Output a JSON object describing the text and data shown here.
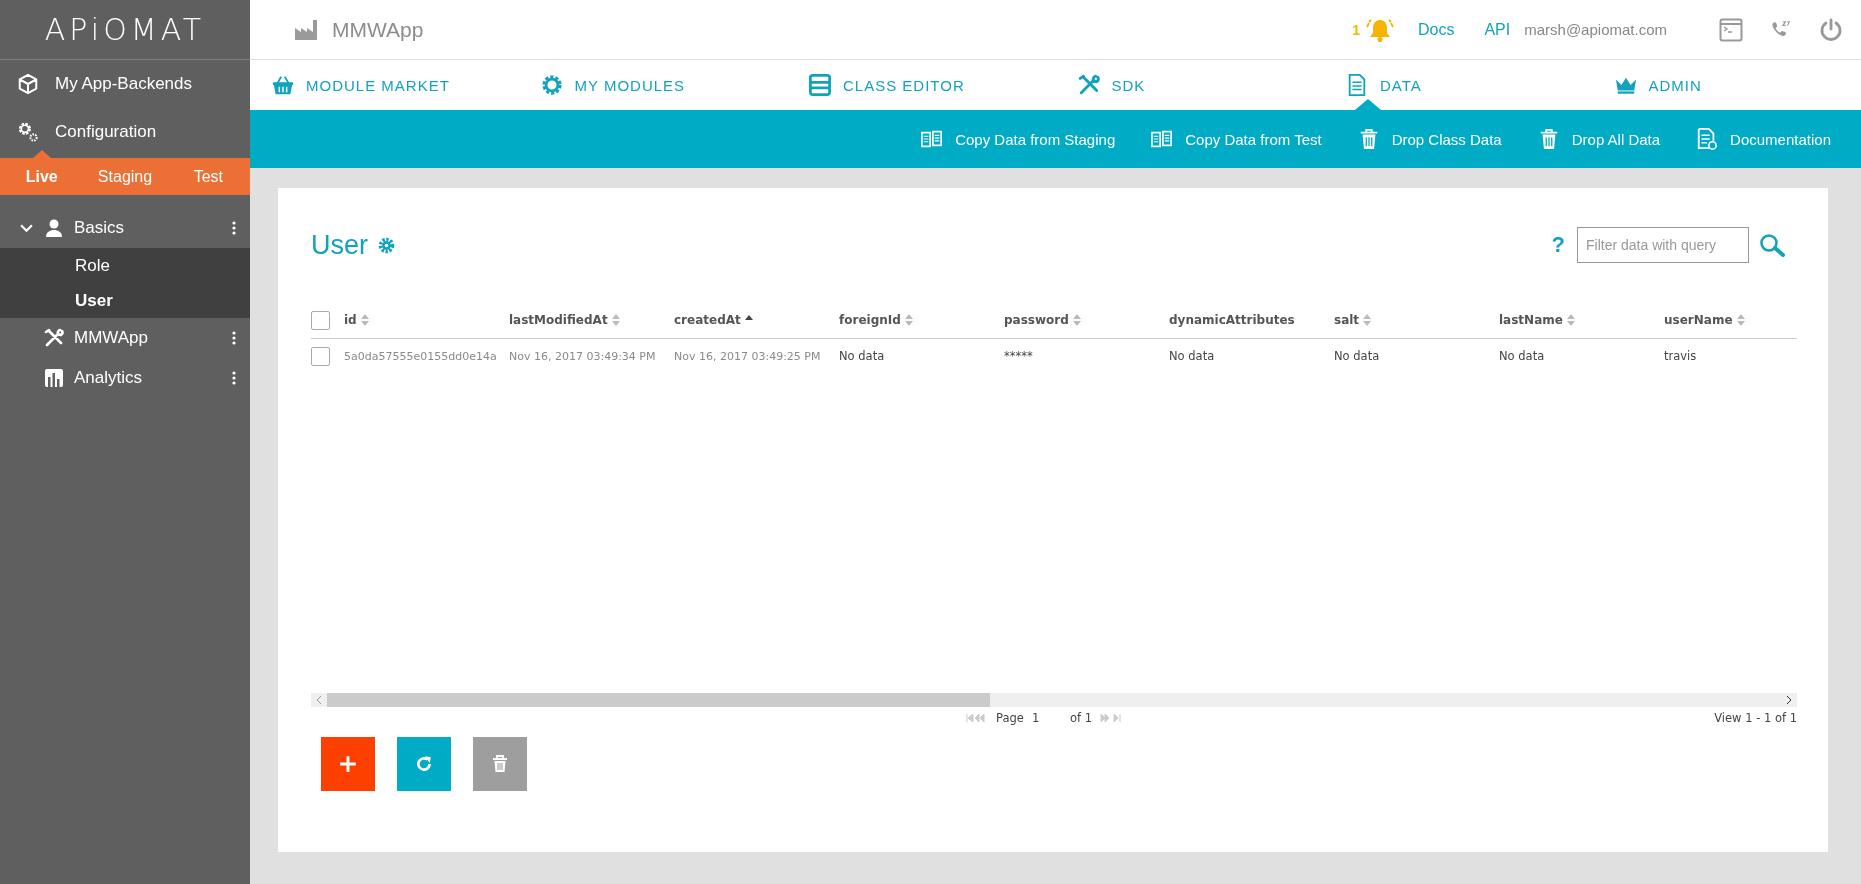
{
  "logo": "APiOMAT",
  "app_title": "MMWApp",
  "header": {
    "notification_count": "1",
    "links": [
      "Docs",
      "API"
    ],
    "user_email": "marsh@apiomat.com"
  },
  "sidebar": {
    "items": [
      {
        "label": "My App-Backends",
        "kind": "backends"
      },
      {
        "label": "Configuration",
        "kind": "configuration"
      }
    ],
    "environments": [
      {
        "label": "Live",
        "selected": true
      },
      {
        "label": "Staging",
        "selected": false
      },
      {
        "label": "Test",
        "selected": false
      }
    ],
    "tree": [
      {
        "label": "Basics",
        "kind": "user",
        "expanded": true,
        "children": [
          {
            "label": "Role",
            "selected": false
          },
          {
            "label": "User",
            "selected": true
          }
        ]
      },
      {
        "label": "MMWApp",
        "kind": "tools"
      },
      {
        "label": "Analytics",
        "kind": "chart"
      }
    ]
  },
  "nav_tabs": [
    {
      "label": "MODULE MARKET",
      "kind": "basket",
      "selected": false
    },
    {
      "label": "MY MODULES",
      "kind": "gear",
      "selected": false
    },
    {
      "label": "CLASS EDITOR",
      "kind": "editor",
      "selected": false
    },
    {
      "label": "SDK",
      "kind": "tools",
      "selected": false
    },
    {
      "label": "DATA",
      "kind": "document",
      "selected": true
    },
    {
      "label": "ADMIN",
      "kind": "crown",
      "selected": false
    }
  ],
  "actions": [
    {
      "label": "Copy Data from Staging",
      "kind": "copy"
    },
    {
      "label": "Copy Data from Test",
      "kind": "copy"
    },
    {
      "label": "Drop Class Data",
      "kind": "trash"
    },
    {
      "label": "Drop All Data",
      "kind": "trash"
    },
    {
      "label": "Documentation",
      "kind": "document"
    }
  ],
  "class_title": "User",
  "filter": {
    "help": "?",
    "placeholder": "Filter data with query"
  },
  "table": {
    "all_checked": false,
    "columns": [
      {
        "label": "id",
        "sortable": true,
        "sorted": false
      },
      {
        "label": "lastModifiedAt",
        "sortable": true,
        "sorted": false
      },
      {
        "label": "createdAt",
        "sortable": true,
        "sorted": true
      },
      {
        "label": "foreignId",
        "sortable": true,
        "sorted": false
      },
      {
        "label": "password",
        "sortable": true,
        "sorted": false
      },
      {
        "label": "dynamicAttributes",
        "sortable": false
      },
      {
        "label": "salt",
        "sortable": true,
        "sorted": false
      },
      {
        "label": "lastName",
        "sortable": true,
        "sorted": false
      },
      {
        "label": "userName",
        "sortable": true,
        "sorted": false
      }
    ],
    "rows": [
      {
        "checked": false,
        "cells": [
          "5a0da57555e0155dd0e14a",
          "Nov 16, 2017 03:49:34 PM",
          "Nov 16, 2017 03:49:25 PM",
          "No data",
          "*****",
          "No data",
          "No data",
          "No data",
          "travis"
        ]
      }
    ]
  },
  "pager": {
    "page_label": "Page",
    "page": "1",
    "of": "of 1",
    "view": "View 1 - 1 of 1"
  },
  "buttons": [
    {
      "kind": "add"
    },
    {
      "kind": "refresh"
    },
    {
      "kind": "delete"
    }
  ]
}
